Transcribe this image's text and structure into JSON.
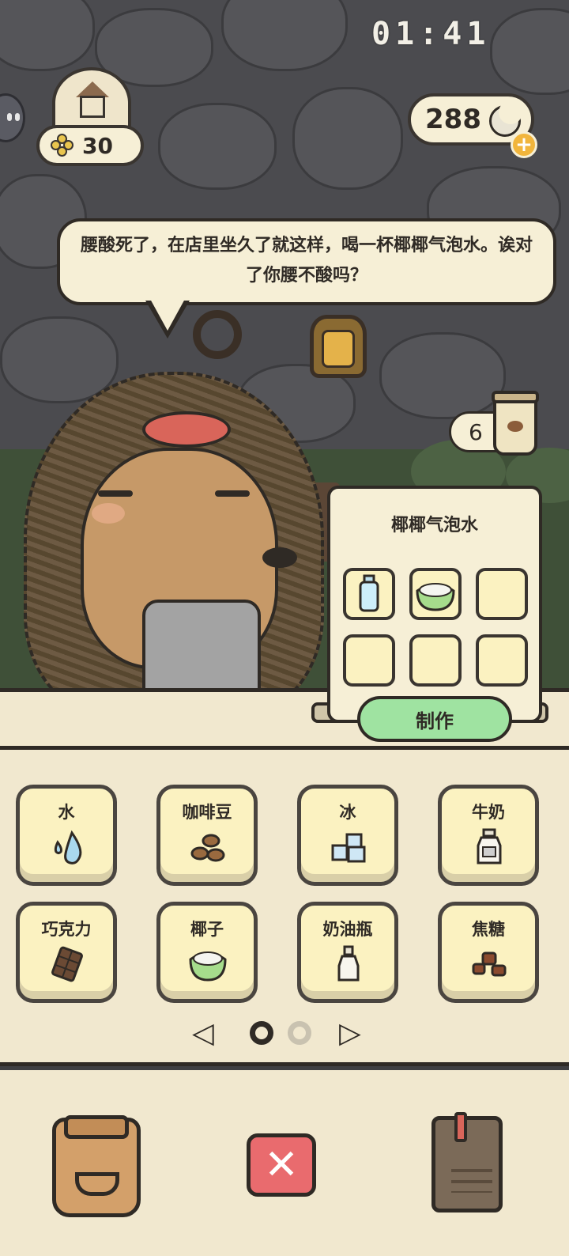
{
  "hud": {
    "clock": "01:41",
    "clover_count": "30",
    "moon_count": "288",
    "moon_plus": "+"
  },
  "dialog": {
    "text": "腰酸死了，在店里坐久了就这样，喝一杯椰椰气泡水。诶对了你腰不酸吗？"
  },
  "order": {
    "cup_count": "6",
    "recipe_name": "椰椰气泡水",
    "slots": [
      "water-bottle",
      "coconut",
      "",
      "",
      "",
      ""
    ],
    "make_button": "制作"
  },
  "ingredients": [
    {
      "label": "水",
      "icon": "water-drop-icon"
    },
    {
      "label": "咖啡豆",
      "icon": "coffee-bean-icon"
    },
    {
      "label": "冰",
      "icon": "ice-cube-icon"
    },
    {
      "label": "牛奶",
      "icon": "milk-bottle-icon"
    },
    {
      "label": "巧克力",
      "icon": "chocolate-icon"
    },
    {
      "label": "椰子",
      "icon": "coconut-icon"
    },
    {
      "label": "奶油瓶",
      "icon": "cream-bottle-icon"
    },
    {
      "label": "焦糖",
      "icon": "caramel-icon"
    }
  ],
  "pager": {
    "prev": "◁",
    "next": "▷",
    "current_page": 1,
    "total_pages": 2
  },
  "bottom": {
    "close": "✕"
  },
  "colors": {
    "cream": "#f6efd6",
    "outline": "#2f2a25",
    "make_green": "#9fe3a1",
    "close_red": "#e96b6e",
    "stone": "#4b4b4f"
  }
}
